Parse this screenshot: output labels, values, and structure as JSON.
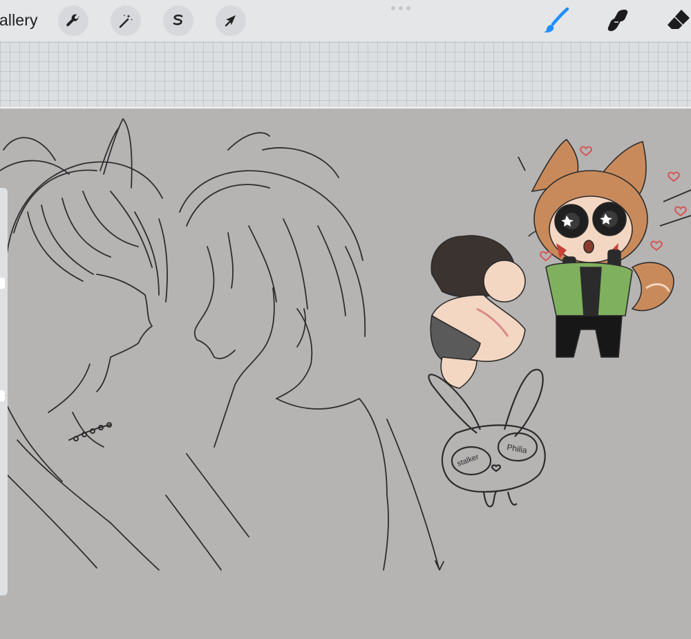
{
  "toolbar": {
    "gallery_label": "allery",
    "left_tools": [
      {
        "name": "actions",
        "icon": "wrench-icon"
      },
      {
        "name": "adjustments",
        "icon": "magic-wand-icon"
      },
      {
        "name": "selection",
        "icon": "selection-s-icon"
      },
      {
        "name": "transform",
        "icon": "arrow-cursor-icon"
      }
    ],
    "right_tools": [
      {
        "name": "brush",
        "icon": "brush-icon",
        "active": true,
        "color": "#1f8fff"
      },
      {
        "name": "smudge",
        "icon": "smudge-hand-icon",
        "active": false
      },
      {
        "name": "eraser",
        "icon": "eraser-icon",
        "active": false
      }
    ]
  },
  "canvas": {
    "background": "#b6b3b3",
    "artwork_labels": {
      "label_left": "stalker",
      "label_right": "Philia"
    }
  }
}
